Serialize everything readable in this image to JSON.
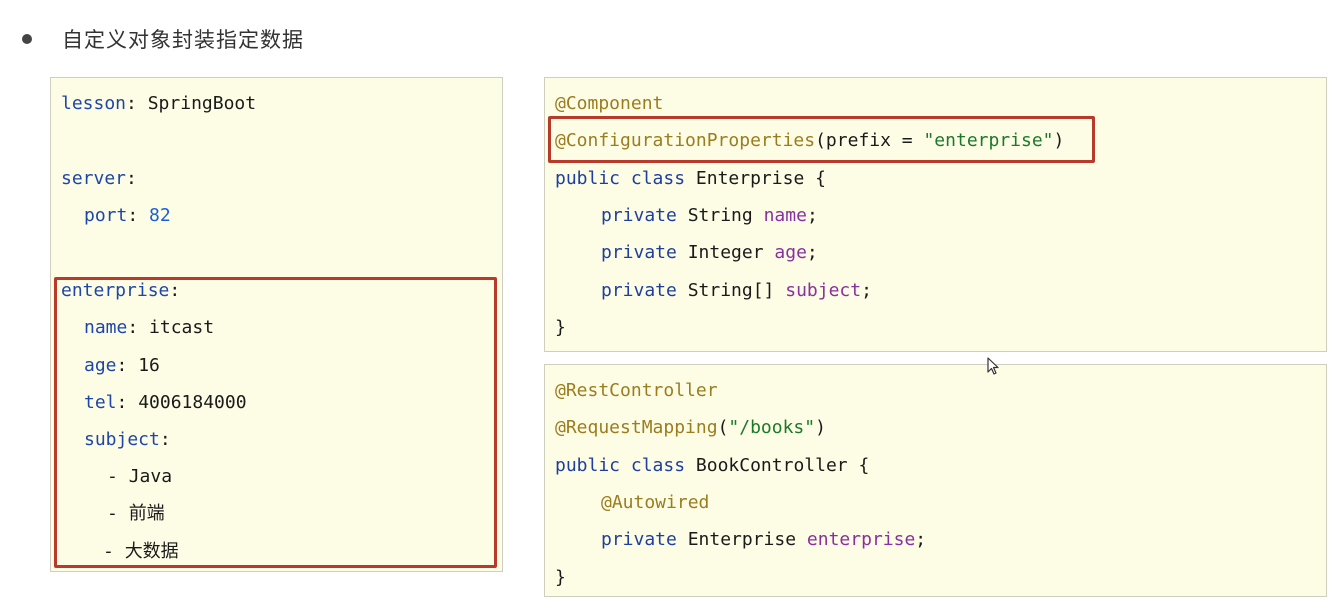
{
  "heading": "自定义对象封装指定数据",
  "yaml_lines": [
    {
      "key": "lesson",
      "sep": ": ",
      "value": "SpringBoot"
    },
    {
      "key": "server",
      "sep": ":",
      "value": ""
    },
    {
      "key": "port",
      "sep": ": ",
      "value": "82"
    },
    {
      "key": "enterprise",
      "sep": ":",
      "value": ""
    },
    {
      "key": "name",
      "sep": ": ",
      "value": "itcast"
    },
    {
      "key": "age",
      "sep": ": ",
      "value": "16"
    },
    {
      "key": "tel",
      "sep": ": ",
      "value": "4006184000"
    },
    {
      "key": "subject",
      "sep": ":",
      "value": ""
    },
    {
      "dash": "- ",
      "value": "Java"
    },
    {
      "dash": "- ",
      "value": "前端"
    },
    {
      "dash": "- ",
      "value": "大数据"
    }
  ],
  "enterprise_class": {
    "ann_component": "@Component",
    "ann_config": "@ConfigurationProperties",
    "config_args_open": "(prefix = ",
    "config_prefix": "\"enterprise\"",
    "config_args_close": ")",
    "decl_public": "public",
    "decl_class": "class",
    "decl_name": "Enterprise {",
    "fields": [
      {
        "modifier": "private",
        "type": "String",
        "name": "name"
      },
      {
        "modifier": "private",
        "type": "Integer",
        "name": "age"
      },
      {
        "modifier": "private",
        "type": "String[]",
        "name": "subject"
      }
    ],
    "close": "}"
  },
  "controller_class": {
    "ann_rest": "@RestController",
    "ann_mapping": "@RequestMapping",
    "mapping_open": "(",
    "mapping_path": "\"/books\"",
    "mapping_close": ")",
    "decl_public": "public",
    "decl_class": "class",
    "decl_name": "BookController {",
    "ann_autowired": "@Autowired",
    "field": {
      "modifier": "private",
      "type": "Enterprise",
      "name": "enterprise"
    },
    "close": "}"
  },
  "colors": {
    "panel_bg": "#fdfce5",
    "highlight_border": "#b83a2a",
    "yaml_key": "#1e46a8",
    "annotation": "#9b7d1f",
    "keyword": "#1e3f9c",
    "field_name": "#8a2fa0",
    "string": "#1b7a2a",
    "number": "#1a5fd8"
  },
  "icons": {
    "bullet": "bullet-dot-icon",
    "cursor": "mouse-pointer-icon"
  }
}
